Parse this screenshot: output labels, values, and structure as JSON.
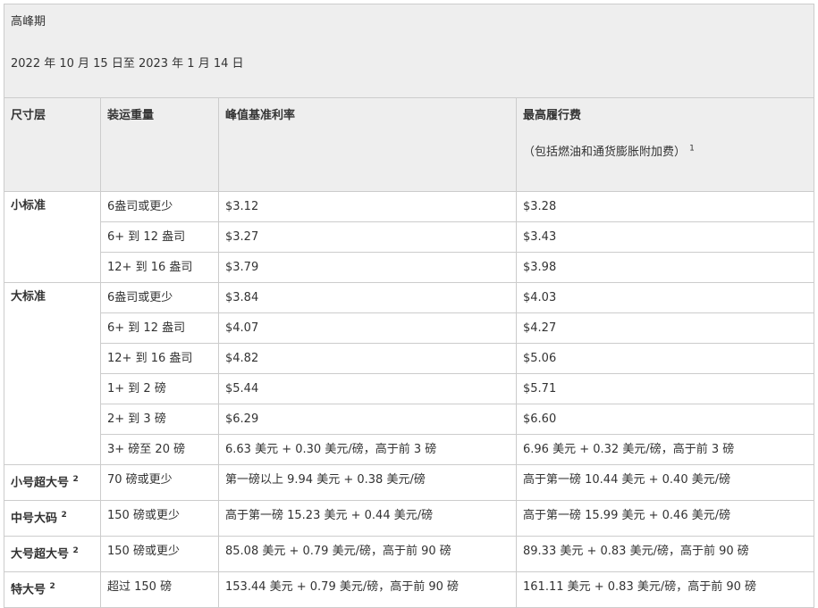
{
  "period": {
    "title": "高峰期",
    "dates": "2022 年 10 月 15 日至 2023 年 1 月 14 日"
  },
  "headers": {
    "size_tier": "尺寸层",
    "weight": "装运重量",
    "base_rate": "峰值基准利率",
    "max_fee": "最高履行费",
    "max_fee_note": "（包括燃油和通货膨胀附加费）",
    "max_fee_note_sup": "1"
  },
  "tiers": [
    {
      "name": "小标准",
      "sup": "",
      "rows": [
        {
          "weight": "6盎司或更少",
          "base": "$3.12",
          "max": "$3.28"
        },
        {
          "weight": "6+ 到 12 盎司",
          "base": "$3.27",
          "max": "$3.43"
        },
        {
          "weight": "12+ 到 16 盎司",
          "base": "$3.79",
          "max": "$3.98"
        }
      ]
    },
    {
      "name": "大标准",
      "sup": "",
      "rows": [
        {
          "weight": "6盎司或更少",
          "base": "$3.84",
          "max": "$4.03"
        },
        {
          "weight": "6+ 到 12 盎司",
          "base": "$4.07",
          "max": "$4.27"
        },
        {
          "weight": "12+ 到 16 盎司",
          "base": "$4.82",
          "max": "$5.06"
        },
        {
          "weight": "1+ 到 2 磅",
          "base": "$5.44",
          "max": "$5.71"
        },
        {
          "weight": "2+ 到 3 磅",
          "base": "$6.29",
          "max": "$6.60"
        },
        {
          "weight": "3+ 磅至 20 磅",
          "base": "6.63 美元 + 0.30 美元/磅，高于前 3 磅",
          "max": "6.96 美元 + 0.32 美元/磅，高于前 3 磅"
        }
      ]
    },
    {
      "name": "小号超大号",
      "sup": "2",
      "rows": [
        {
          "weight": "70 磅或更少",
          "base": "第一磅以上 9.94 美元 + 0.38 美元/磅",
          "max": "高于第一磅 10.44 美元 + 0.40 美元/磅"
        }
      ]
    },
    {
      "name": "中号大码",
      "sup": "2",
      "rows": [
        {
          "weight": "150 磅或更少",
          "base": "高于第一磅 15.23 美元 + 0.44 美元/磅",
          "max": "高于第一磅 15.99 美元 + 0.46 美元/磅"
        }
      ]
    },
    {
      "name": "大号超大号",
      "sup": "2",
      "rows": [
        {
          "weight": "150 磅或更少",
          "base": "85.08 美元 + 0.79 美元/磅，高于前 90 磅",
          "max": "89.33 美元 + 0.83 美元/磅，高于前 90 磅"
        }
      ]
    },
    {
      "name": "特大号",
      "sup": "2",
      "rows": [
        {
          "weight": "超过 150 磅",
          "base": "153.44 美元 + 0.79 美元/磅，高于前 90 磅",
          "max": "161.11 美元 + 0.83 美元/磅，高于前 90 磅"
        }
      ]
    }
  ]
}
